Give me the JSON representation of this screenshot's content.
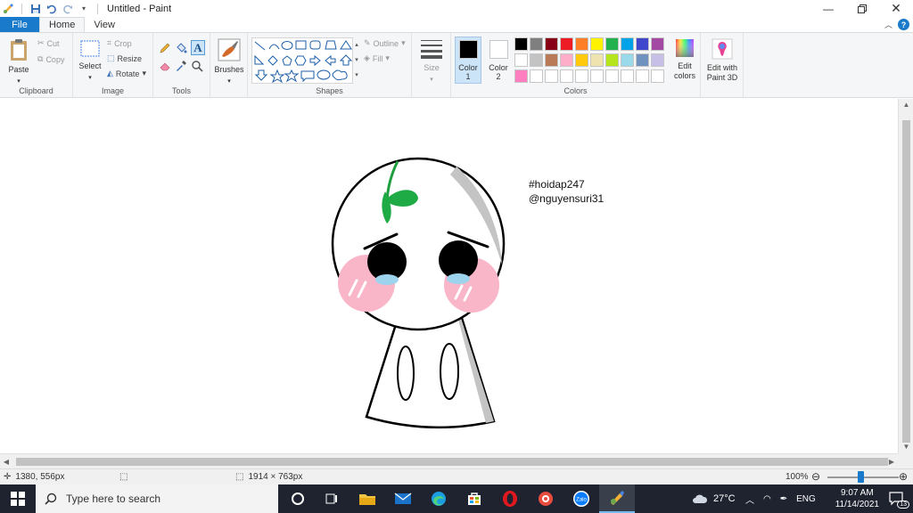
{
  "window": {
    "title": "Untitled - Paint"
  },
  "tabs": {
    "file": "File",
    "home": "Home",
    "view": "View"
  },
  "ribbon": {
    "clipboard": {
      "label": "Clipboard",
      "paste": "Paste",
      "cut": "Cut",
      "copy": "Copy"
    },
    "image": {
      "label": "Image",
      "select": "Select",
      "crop": "Crop",
      "resize": "Resize",
      "rotate": "Rotate"
    },
    "tools": {
      "label": "Tools"
    },
    "brushes": {
      "label": "Brushes"
    },
    "shapes": {
      "label": "Shapes",
      "outline": "Outline",
      "fill": "Fill"
    },
    "size": {
      "label": "Size"
    },
    "colors": {
      "label": "Colors",
      "color1": "Color 1",
      "color2": "Color 2",
      "edit_colors": "Edit colors",
      "edit_with_paint3d": "Edit with Paint 3D",
      "color1_value": "#000000",
      "color2_value": "#ffffff",
      "palette_row1": [
        "#000000",
        "#7f7f7f",
        "#880015",
        "#ed1c24",
        "#ff7f27",
        "#fff200",
        "#22b14c",
        "#00a2e8",
        "#3f48cc",
        "#a349a4"
      ],
      "palette_row2": [
        "#ffffff",
        "#c3c3c3",
        "#b97a57",
        "#ffaec9",
        "#ffc90e",
        "#efe4b0",
        "#b5e61d",
        "#99d9ea",
        "#7092be",
        "#c8bfe7"
      ],
      "palette_row3": [
        "#ff7ec0",
        "#ffffff",
        "#ffffff",
        "#ffffff",
        "#ffffff",
        "#ffffff",
        "#ffffff",
        "#ffffff",
        "#ffffff",
        "#ffffff"
      ]
    }
  },
  "canvas": {
    "text_line1": "#hoidap247",
    "text_line2": "@nguyensuri31"
  },
  "status": {
    "cursor_pos": "1380, 556px",
    "image_size": "1914 × 763px",
    "zoom": "100%"
  },
  "taskbar": {
    "search_placeholder": "Type here to search",
    "weather": "27°C",
    "language": "ENG",
    "time": "9:07 AM",
    "date": "11/14/2021",
    "notifications": "13"
  }
}
